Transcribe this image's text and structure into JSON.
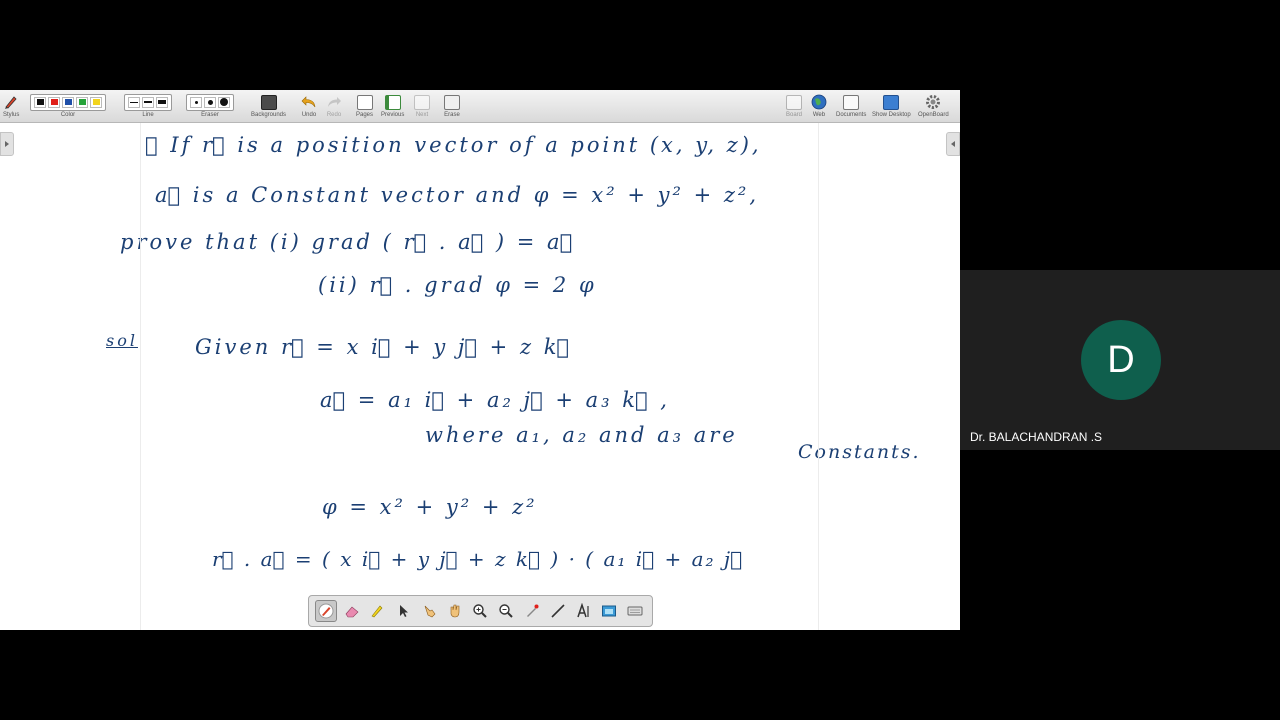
{
  "toolbar": {
    "stylus": "Stylus",
    "color": "Color",
    "line": "Line",
    "eraser": "Eraser",
    "backgrounds": "Backgrounds",
    "undo": "Undo",
    "redo": "Redo",
    "pages": "Pages",
    "previous": "Previous",
    "next": "Next",
    "erase": "Erase",
    "board": "Board",
    "web": "Web",
    "documents": "Documents",
    "show_desktop": "Show Desktop",
    "openboard": "OpenBoard"
  },
  "colors": {
    "swatches": [
      "#111111",
      "#e0201b",
      "#1f4fa8",
      "#27a33a",
      "#f2d41d"
    ],
    "ink": "#1b3f73",
    "avatar_bg": "#0f5f4d"
  },
  "board": {
    "lines": [
      "① If r⃗ is a position vector of a point (x, y, z),",
      "a⃗ is a Constant vector and φ = x² + y² + z²,",
      "prove that  (i) grad ( r⃗ . a⃗ ) = a⃗",
      "(ii)  r⃗ . grad φ = 2 φ",
      "sol",
      "Given  r⃗ = x i⃗ + y j⃗ + z k⃗",
      "a⃗ = a₁ i⃗ + a₂ j⃗ + a₃ k⃗ ,",
      "where a₁, a₂ and a₃ are",
      "Constants.",
      "φ = x² + y² + z²",
      "r⃗ . a⃗ = ( x i⃗ + y j⃗ + z k⃗ ) · ( a₁ i⃗ + a₂ j⃗"
    ]
  },
  "participant": {
    "initial": "D",
    "name": "Dr. BALACHANDRAN .S"
  }
}
